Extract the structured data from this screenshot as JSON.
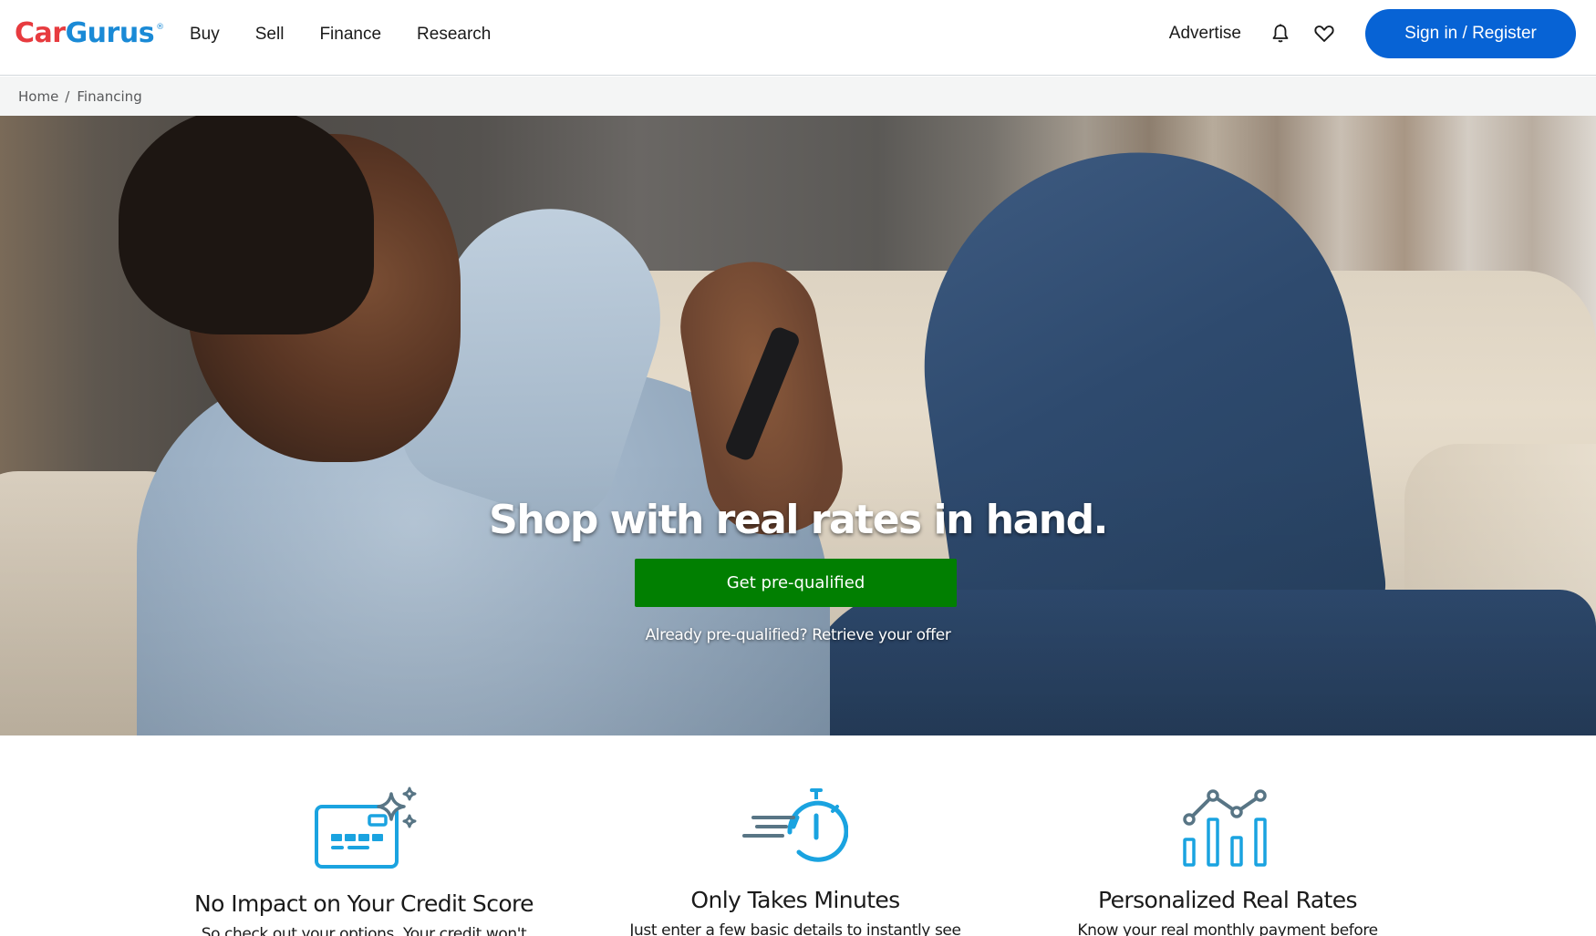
{
  "header": {
    "logo": {
      "part1": "Car",
      "part2": "Gurus",
      "registered": "®"
    },
    "nav": [
      "Buy",
      "Sell",
      "Finance",
      "Research"
    ],
    "advertise": "Advertise",
    "icons": {
      "notifications": "bell-icon",
      "saved": "heart-icon"
    },
    "sign_in_label": "Sign in / Register"
  },
  "breadcrumb": {
    "items": [
      "Home",
      "Financing"
    ],
    "separator": "/"
  },
  "hero": {
    "headline": "Shop with real rates in hand.",
    "cta_label": "Get pre-qualified",
    "retrieve_prefix": "Already pre-qualified?",
    "retrieve_link": "Retrieve your offer"
  },
  "features": [
    {
      "icon": "credit-card-sparkle-icon",
      "title": "No Impact on Your Credit Score",
      "desc": "So check out your options. Your credit won't"
    },
    {
      "icon": "stopwatch-icon",
      "title": "Only Takes Minutes",
      "desc": "Just enter a few basic details to instantly see"
    },
    {
      "icon": "chart-rates-icon",
      "title": "Personalized Real Rates",
      "desc": "Know your real monthly payment before"
    }
  ],
  "colors": {
    "brand_red": "#e73b3f",
    "brand_blue": "#1a8ad6",
    "signin_blue": "#0763d5",
    "cta_green": "#017f01",
    "icon_blue": "#1aa3e0",
    "icon_slate": "#587585"
  }
}
